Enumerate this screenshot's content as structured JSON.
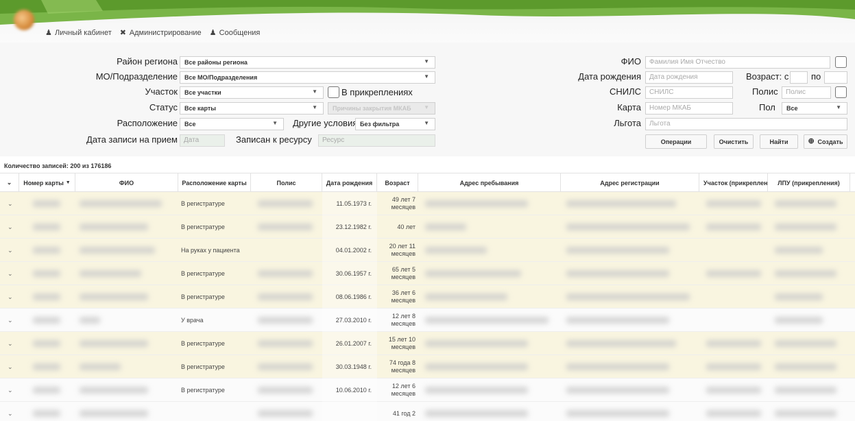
{
  "topnav": {
    "cabinet": "Личный кабинет",
    "admin": "Администрирование",
    "messages": "Сообщения"
  },
  "filters": {
    "region_label": "Район региона",
    "region_value": "Все районы региона",
    "mo_label": "МО/Подразделение",
    "mo_value": "Все МО/Подразделения",
    "uchastok_label": "Участок",
    "uchastok_value": "Все участки",
    "attached_label": "В прикреплениях",
    "status_label": "Статус",
    "status_value": "Все карты",
    "close_reasons": "Причины закрытия МКАБ",
    "location_label": "Расположение",
    "location_value": "Все",
    "other_label": "Другие условия",
    "other_value": "Без фильтра",
    "record_date_label": "Дата записи на прием",
    "record_date_placeholder": "Дата",
    "resource_label": "Записан к ресурсу",
    "resource_placeholder": "Ресурс",
    "fio_label": "ФИО",
    "fio_placeholder": "Фамилия Имя Отчество",
    "dob_label": "Дата рождения",
    "dob_placeholder": "Дата рождения",
    "age_label": "Возраст: с",
    "age_to": "по",
    "snils_label": "СНИЛС",
    "snils_placeholder": "СНИЛС",
    "polis_label": "Полис",
    "polis_placeholder": "Полис",
    "card_label": "Карта",
    "card_placeholder": "Номер МКАБ",
    "sex_label": "Пол",
    "sex_value": "Все",
    "lgota_label": "Льгота",
    "lgota_placeholder": "Льгота",
    "btn_operations": "Операции",
    "btn_clear": "Очистить",
    "btn_find": "Найти",
    "btn_create": "Создать"
  },
  "count_text": "Количество записей: 200 из 176186",
  "table": {
    "headers": [
      "Номер карты",
      "ФИО",
      "Расположение карты",
      "Полис",
      "Дата рождения",
      "Возраст",
      "Адрес пребывания",
      "Адрес регистрации",
      "Участок (прикреплени",
      "ЛПУ (прикрепления)"
    ],
    "rows": [
      {
        "location": "В регистратуре",
        "dob": "11.05.1973 г.",
        "age1": "49 лет 7",
        "age2": "месяцев",
        "tone": "y"
      },
      {
        "location": "В регистратуре",
        "dob": "23.12.1982 г.",
        "age1": "40 лет",
        "age2": "",
        "tone": "y"
      },
      {
        "location": "На руках у пациента",
        "dob": "04.01.2002 г.",
        "age1": "20 лет 11",
        "age2": "месяцев",
        "tone": "y"
      },
      {
        "location": "В регистратуре",
        "dob": "30.06.1957 г.",
        "age1": "65 лет 5",
        "age2": "месяцев",
        "tone": "y"
      },
      {
        "location": "В регистратуре",
        "dob": "08.06.1986 г.",
        "age1": "36 лет 6",
        "age2": "месяцев",
        "tone": "y"
      },
      {
        "location": "У врача",
        "dob": "27.03.2010 г.",
        "age1": "12 лет 8",
        "age2": "месяцев",
        "tone": "w"
      },
      {
        "location": "В регистратуре",
        "dob": "26.01.2007 г.",
        "age1": "15 лет 10",
        "age2": "месяцев",
        "tone": "y"
      },
      {
        "location": "В регистратуре",
        "dob": "30.03.1948 г.",
        "age1": "74 года 8",
        "age2": "месяцев",
        "tone": "y"
      },
      {
        "location": "В регистратуре",
        "dob": "10.06.2010 г.",
        "age1": "12 лет 6",
        "age2": "месяцев",
        "tone": "w"
      },
      {
        "location": "",
        "dob": "",
        "age1": "41 год 2",
        "age2": "",
        "tone": "w"
      }
    ]
  }
}
